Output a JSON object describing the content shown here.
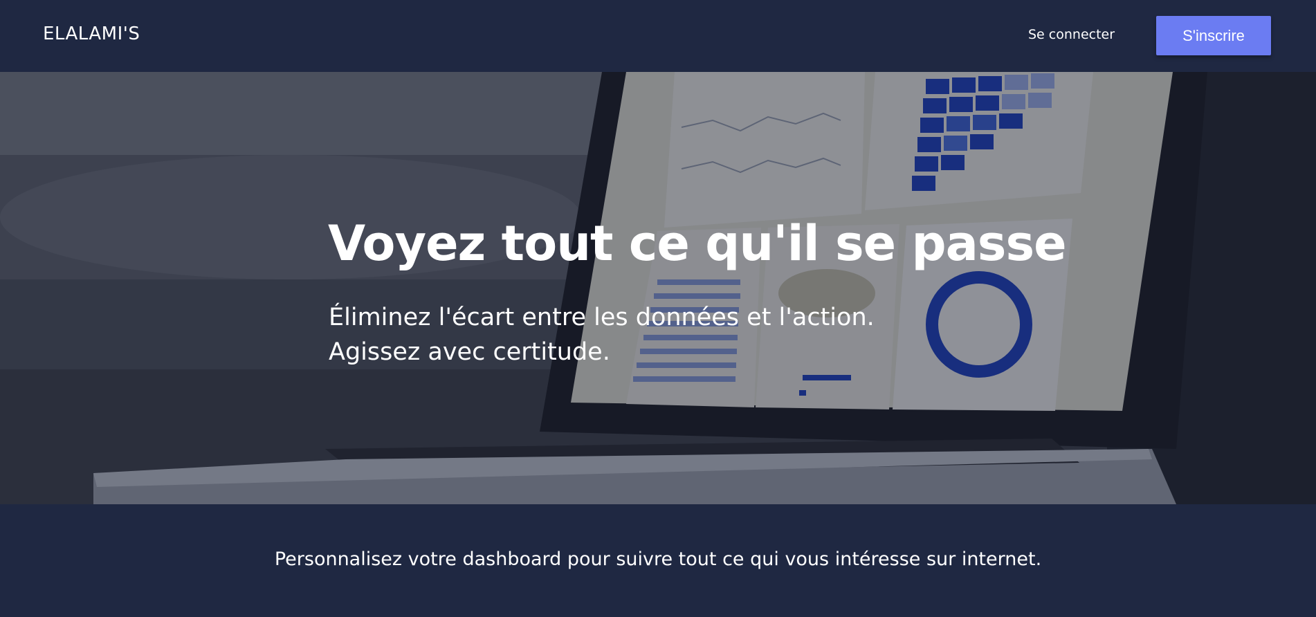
{
  "navbar": {
    "brand": "ELALAMI'S",
    "login_label": "Se connecter",
    "signup_label": "S'inscrire"
  },
  "hero": {
    "title": "Voyez tout ce qu'il se passe",
    "subtitle": "Éliminez l'écart entre les données et l'action. Agissez avec certitude.",
    "background_icon": "laptop-analytics-photo"
  },
  "footer": {
    "text": "Personnalisez votre dashboard pour suivre tout ce qui vous intéresse sur internet."
  },
  "colors": {
    "nav_background": "#1f2842",
    "accent": "#6b7cf2",
    "text": "#ffffff"
  }
}
